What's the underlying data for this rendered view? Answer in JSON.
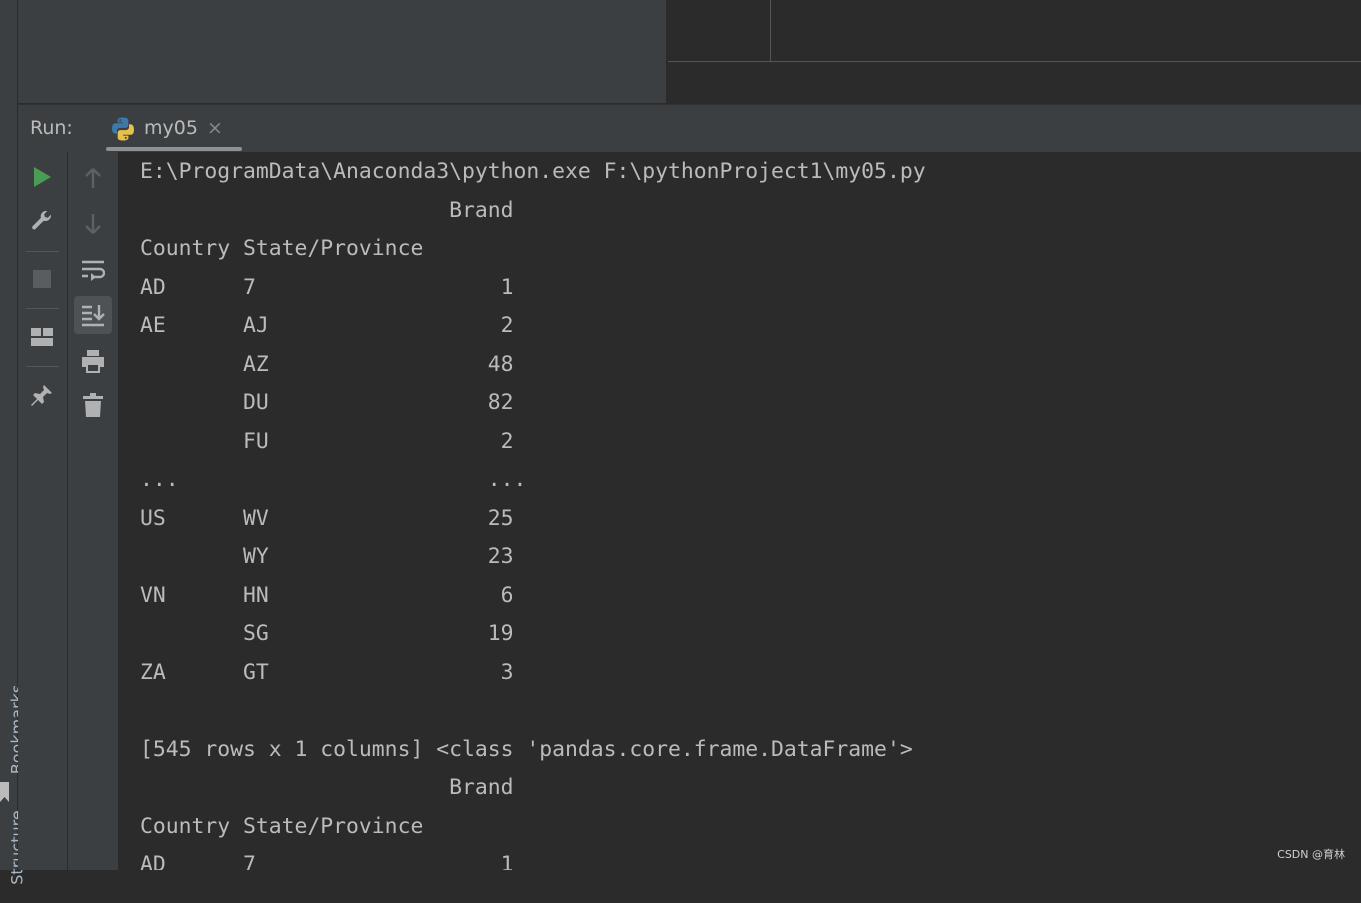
{
  "side_tools": {
    "bookmarks": "Bookmarks",
    "structure": "Structure"
  },
  "run_window": {
    "label": "Run:",
    "tab": {
      "title": "my05",
      "close": "×",
      "icon": "python-icon"
    }
  },
  "toolbar_left": [
    "run-icon",
    "wrench-icon",
    "stop-icon",
    "layout-icon",
    "pin-icon"
  ],
  "toolbar_right": [
    "up-arrow-icon",
    "down-arrow-icon",
    "soft-wrap-icon",
    "scroll-to-end-icon",
    "print-icon",
    "trash-icon"
  ],
  "console": {
    "lines": [
      "E:\\ProgramData\\Anaconda3\\python.exe F:\\pythonProject1\\my05.py",
      "                        Brand",
      "Country State/Province",
      "AD      7                   1",
      "AE      AJ                  2",
      "        AZ                 48",
      "        DU                 82",
      "        FU                  2",
      "...                        ...",
      "US      WV                 25",
      "        WY                 23",
      "VN      HN                  6",
      "        SG                 19",
      "ZA      GT                  3",
      "",
      "[545 rows x 1 columns] <class 'pandas.core.frame.DataFrame'>",
      "                        Brand",
      "Country State/Province",
      "AD      7                   1"
    ]
  },
  "watermark": "CSDN @育林",
  "colors": {
    "run_green": "#499c54",
    "text": "#bbbbbb",
    "bg": "#2b2b2b",
    "panel": "#3c3f41"
  }
}
